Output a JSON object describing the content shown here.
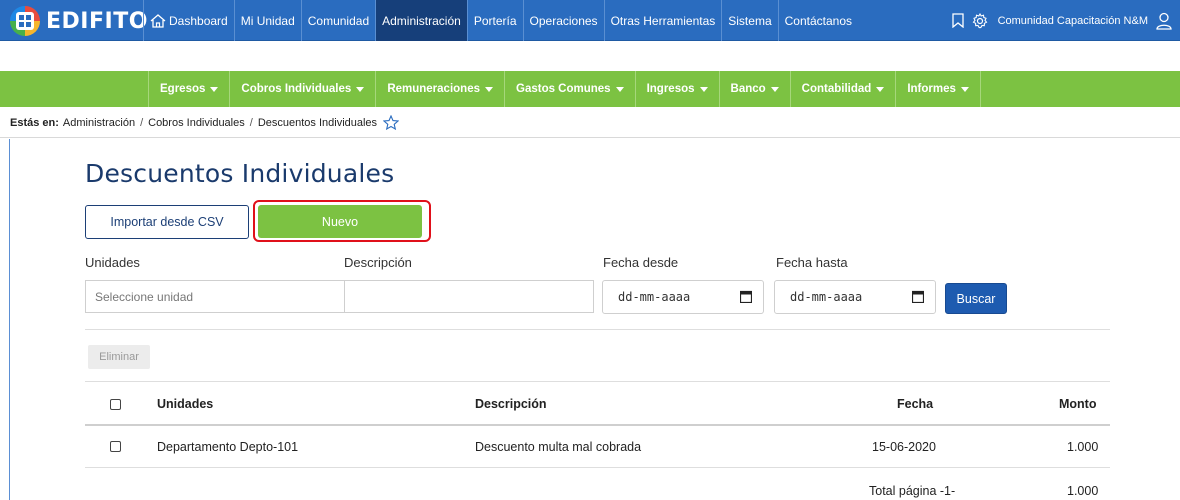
{
  "header": {
    "logo_text": "EDIFITO",
    "nav": [
      {
        "label": "Dashboard",
        "active": false
      },
      {
        "label": "Mi Unidad",
        "active": false
      },
      {
        "label": "Comunidad",
        "active": false
      },
      {
        "label": "Administración",
        "active": true
      },
      {
        "label": "Portería",
        "active": false
      },
      {
        "label": "Operaciones",
        "active": false
      },
      {
        "label": "Otras Herramientas",
        "active": false
      },
      {
        "label": "Sistema",
        "active": false
      },
      {
        "label": "Contáctanos",
        "active": false
      }
    ],
    "user_label": "Comunidad Capacitación N&M",
    "icons": [
      "home-icon",
      "bookmark-icon",
      "gear-icon",
      "user-icon"
    ]
  },
  "subnav": {
    "items": [
      "Egresos",
      "Cobros Individuales",
      "Remuneraciones",
      "Gastos Comunes",
      "Ingresos",
      "Banco",
      "Contabilidad",
      "Informes"
    ]
  },
  "breadcrumb": {
    "prefix": "Estás en:",
    "items": [
      "Administración",
      "Cobros Individuales",
      "Descuentos Individuales"
    ],
    "separator": "/"
  },
  "page": {
    "title": "Descuentos Individuales",
    "import_button": "Importar desde CSV",
    "new_button": "Nuevo"
  },
  "filters": {
    "units_label": "Unidades",
    "units_placeholder": "Seleccione unidad",
    "description_label": "Descripción",
    "description_value": "",
    "date_from_label": "Fecha desde",
    "date_from_value": "dd-mm-aaaa",
    "date_to_label": "Fecha hasta",
    "date_to_value": "dd-mm-aaaa",
    "search_button": "Buscar"
  },
  "table": {
    "delete_button": "Eliminar",
    "headers": {
      "units": "Unidades",
      "description": "Descripción",
      "date": "Fecha",
      "amount": "Monto"
    },
    "rows": [
      {
        "units": "Departamento Depto-101",
        "description": "Descuento multa mal cobrada",
        "date": "15-06-2020",
        "amount": "1.000"
      }
    ],
    "footer": {
      "label": "Total página -1-",
      "amount": "1.000"
    }
  },
  "colors": {
    "top_nav": "#2a6cbf",
    "top_nav_active": "#163f7a",
    "sub_nav": "#7cc242",
    "primary_button": "#1e5bb0",
    "new_button": "#7cc242",
    "highlight": "#e0101a"
  }
}
